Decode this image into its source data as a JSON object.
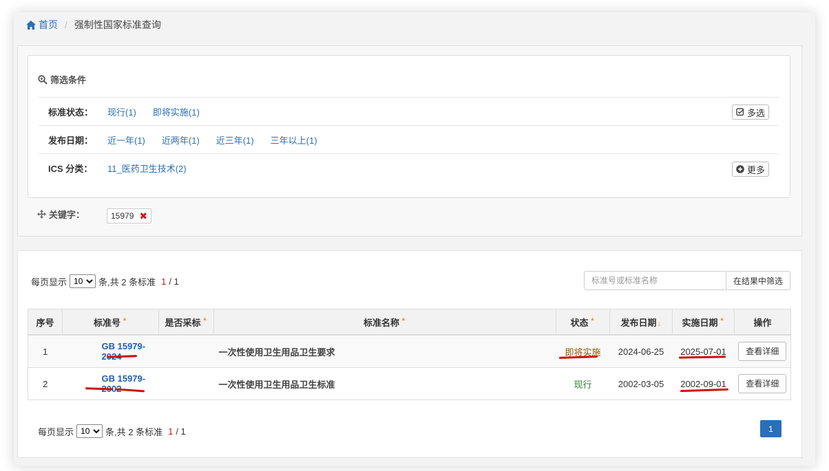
{
  "breadcrumb": {
    "home": "首页",
    "current": "强制性国家标准查询"
  },
  "filters": {
    "title": "筛选条件",
    "status": {
      "label": "标准状态：",
      "options": [
        "现行(1)",
        "即将实施(1)"
      ],
      "multi_btn": "多选"
    },
    "date": {
      "label": "发布日期：",
      "options": [
        "近一年(1)",
        "近两年(1)",
        "近三年(1)",
        "三年以上(1)"
      ]
    },
    "ics": {
      "label": "ICS 分类：",
      "options": [
        "11_医药卫生技术(2)"
      ],
      "more_btn": "更多"
    },
    "keyword": {
      "label": "关键字：",
      "value": "15979",
      "remove": "✖"
    }
  },
  "pager_top": {
    "prefix": "每页显示",
    "size": "10",
    "suffix": "条,共 2 条标准",
    "page_cur": "1",
    "page_total": "/ 1"
  },
  "pager_bottom": {
    "prefix": "每页显示",
    "size": "10",
    "suffix": "条,共 2 条标准",
    "page_cur": "1",
    "page_total": "/ 1",
    "page_btn": "1"
  },
  "search": {
    "placeholder": "标准号或标准名称",
    "button": "在结果中筛选"
  },
  "table": {
    "headers": [
      "序号",
      "标准号",
      "是否采标",
      "标准名称",
      "状态",
      "发布日期",
      "实施日期",
      "操作"
    ],
    "rows": [
      {
        "no": "1",
        "code": "GB 15979-2024",
        "adopt": "",
        "name": "一次性使用卫生用品卫生要求",
        "status": "即将实施",
        "pub": "2024-06-25",
        "impl": "2025-07-01",
        "action": "查看详细"
      },
      {
        "no": "2",
        "code": "GB 15979-2002",
        "adopt": "",
        "name": "一次性使用卫生用品卫生标准",
        "status": "现行",
        "pub": "2002-03-05",
        "impl": "2002-09-01",
        "action": "查看详细"
      }
    ]
  },
  "colors": {
    "link": "#2a6fb7",
    "accent_red": "#d01616",
    "sort_arrow": "#f0a030",
    "page_btn": "#2a6fb7"
  }
}
